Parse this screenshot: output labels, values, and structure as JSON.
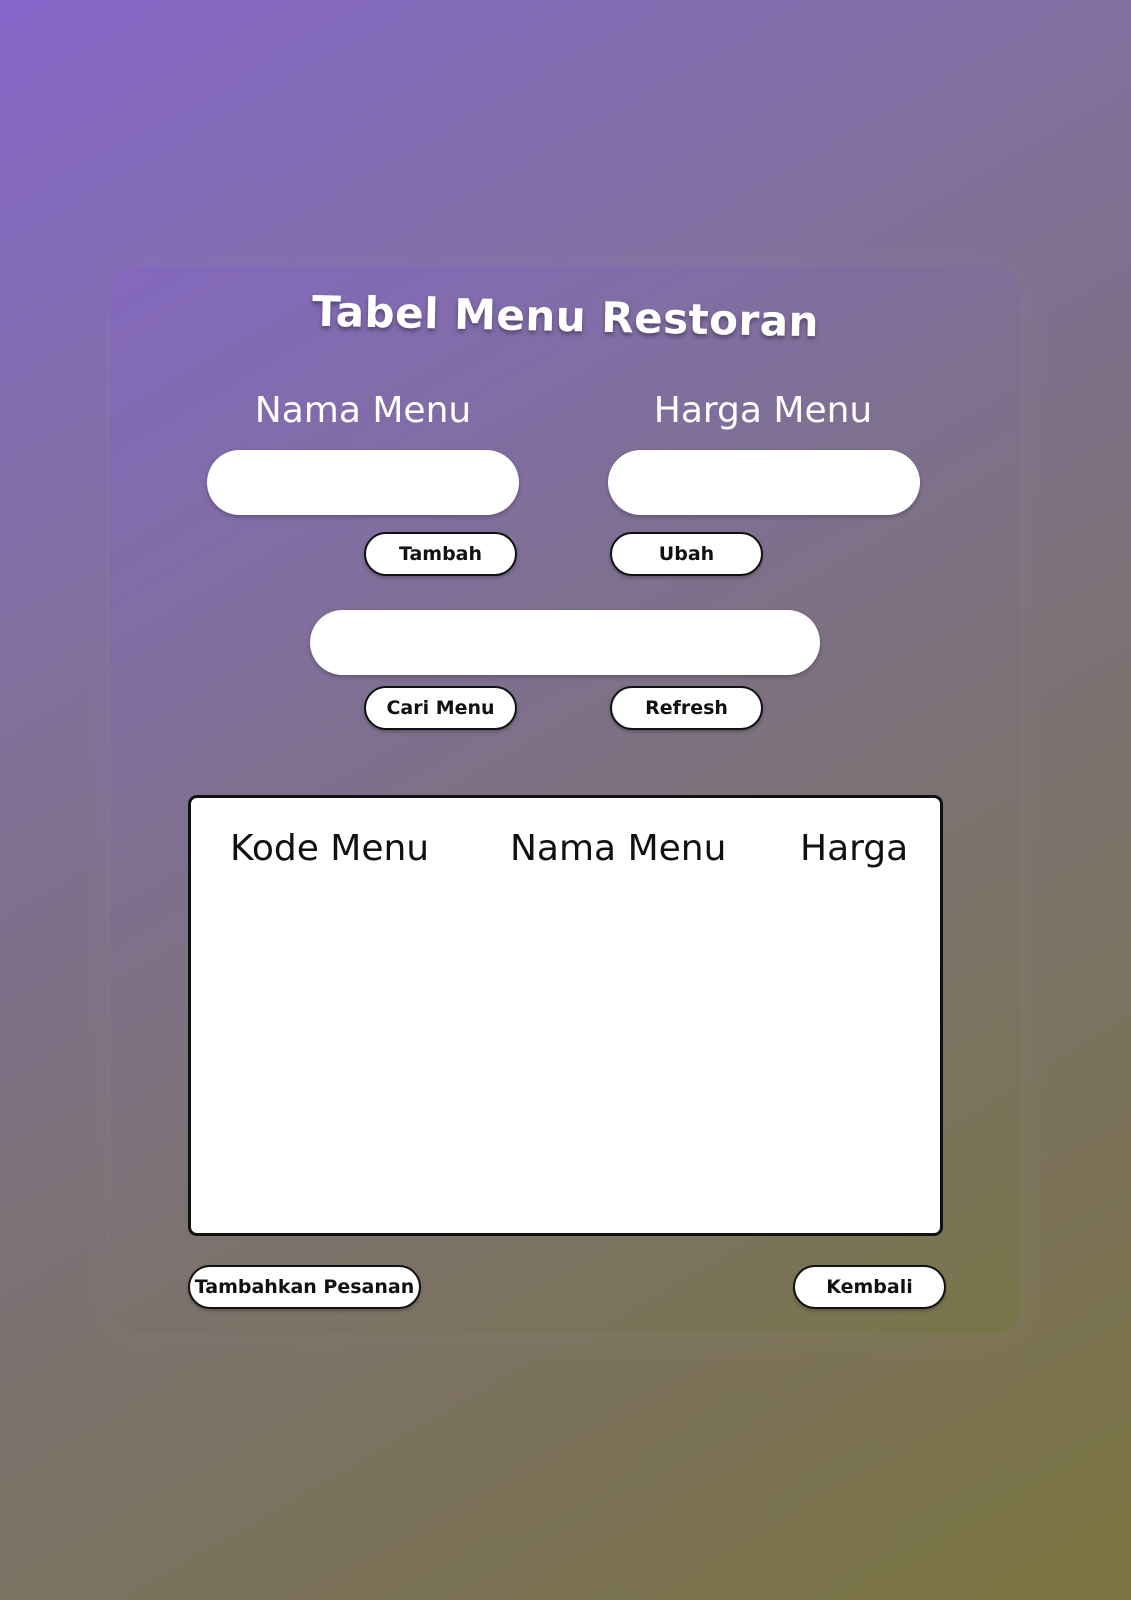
{
  "page": {
    "title": "Tabel Menu Restoran"
  },
  "form": {
    "nama_menu_label": "Nama Menu",
    "harga_menu_label": "Harga Menu",
    "nama_menu_value": "",
    "harga_menu_value": "",
    "search_value": ""
  },
  "buttons": {
    "tambah": "Tambah",
    "ubah": "Ubah",
    "cari_menu": "Cari Menu",
    "refresh": "Refresh",
    "tambahkan_pesanan": "Tambahkan Pesanan",
    "kembali": "Kembali"
  },
  "table": {
    "columns": [
      "Kode Menu",
      "Nama Menu",
      "Harga"
    ],
    "rows": []
  },
  "colors": {
    "background_start": "#8566c9",
    "background_end": "#7a7440",
    "input_fill": "#ffffff",
    "button_border": "#111111"
  }
}
